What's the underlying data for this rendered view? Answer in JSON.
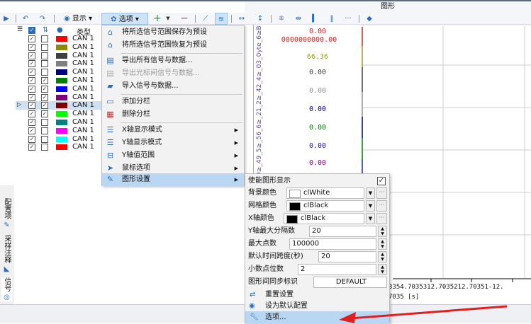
{
  "window": {
    "title": "图形"
  },
  "toolbar": {
    "display_label": "显示",
    "options_label": "选项"
  },
  "list": {
    "header_type": "类型",
    "rows": [
      {
        "visible": true,
        "axis": false,
        "color": "#ff0000",
        "type": "CAN 1"
      },
      {
        "visible": true,
        "axis": false,
        "color": "#8b8b00",
        "type": "CAN 1"
      },
      {
        "visible": true,
        "axis": false,
        "color": "#404040",
        "type": "CAN 1"
      },
      {
        "visible": true,
        "axis": false,
        "color": "#808080",
        "type": "CAN 1"
      },
      {
        "visible": true,
        "axis": false,
        "color": "#000080",
        "type": "CAN 1"
      },
      {
        "visible": true,
        "axis": true,
        "color": "#008000",
        "type": "CAN 1"
      },
      {
        "visible": true,
        "axis": true,
        "color": "#0000ff",
        "type": "CAN 1"
      },
      {
        "visible": true,
        "axis": true,
        "color": "#800080",
        "type": "CAN 1"
      },
      {
        "visible": true,
        "axis": true,
        "color": "#800000",
        "type": "CAN 1"
      },
      {
        "visible": true,
        "axis": true,
        "color": "#00ff00",
        "type": "CAN 1"
      },
      {
        "visible": true,
        "axis": false,
        "color": "#008080",
        "type": "CAN 1"
      },
      {
        "visible": true,
        "axis": false,
        "color": "#ff00ff",
        "type": "CAN 1"
      },
      {
        "visible": true,
        "axis": false,
        "color": "#00ffff",
        "type": "CAN 1"
      },
      {
        "visible": true,
        "axis": false,
        "color": "#ff0000",
        "type": "CAN 1"
      }
    ]
  },
  "menu": {
    "items": [
      "将所选信号范围保存为预设",
      "将所选信号范围恢复为预设",
      "导出所有信号与数据...",
      "导出光标间信号与数据...",
      "导入信号与数据...",
      "添加分栏",
      "删除分栏",
      "X轴显示模式",
      "Y轴显示模式",
      "Y轴值范围",
      "鼠标选项",
      "图形设置"
    ]
  },
  "submenu": {
    "enable_label": "使能图形显示",
    "enable_checked": true,
    "bg_label": "背景颜色",
    "bg_value": "clWhite",
    "grid_label": "网格颜色",
    "grid_value": "clBlack",
    "xaxis_label": "X轴颜色",
    "xaxis_value": "clBlack",
    "ymax_label": "Y轴最大分隔数",
    "ymax_value": "20",
    "maxpts_label": "最大点数",
    "maxpts_value": "100000",
    "span_label": "默认时间跨度(秒)",
    "span_value": "20",
    "dec_label": "小数点位数",
    "dec_value": "2",
    "sync_label": "图形间同步标识",
    "sync_value": "DEFAULT",
    "reset_label": "重置设置",
    "default_label": "设为默认配置",
    "options_label": "选项..."
  },
  "plot": {
    "signal_names": "≥_06_0≥_49_5≥_56_6≥_21_2≥_42_4≥_03_0yte_6≥Byte_(",
    "values": [
      {
        "v": "0.00",
        "c": "#e02020"
      },
      {
        "v": "0000000000.00",
        "c": "#e02020"
      },
      {
        "v": "66.36",
        "c": "#9a9a20"
      },
      {
        "v": "0.00",
        "c": "#404040"
      },
      {
        "v": "0.00",
        "c": "#909090"
      },
      {
        "v": "0.00",
        "c": "#000080"
      },
      {
        "v": "0.00",
        "c": "#008000"
      },
      {
        "v": "0.00",
        "c": "#2020c0"
      },
      {
        "v": "0.00",
        "c": "#800080"
      }
    ],
    "xticks": "3354.7035312.7035212.70351-12.",
    "xunit": "7035 [s]"
  },
  "side_tabs": [
    "配置项",
    "采样注释",
    "信号"
  ]
}
